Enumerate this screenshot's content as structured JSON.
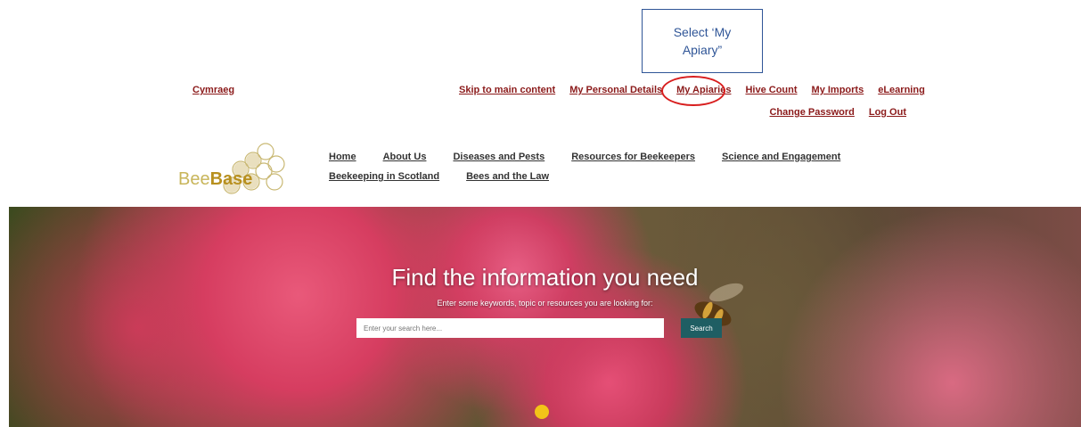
{
  "annotation": {
    "line1": "Select ‘My",
    "line2": "Apiary”"
  },
  "language_link": "Cymraeg",
  "utility_nav": [
    "Skip to main content",
    "My Personal Details",
    "My Apiaries",
    "Hive Count",
    "My Imports",
    "eLearning"
  ],
  "account_nav": [
    "Change Password",
    "Log Out"
  ],
  "logo": {
    "part1": "Bee",
    "part2": "Base"
  },
  "main_nav": {
    "row1": [
      "Home",
      "About Us",
      "Diseases and Pests",
      "Resources for Beekeepers",
      "Science and Engagement"
    ],
    "row2": [
      "Beekeeping in Scotland",
      "Bees and the Law"
    ]
  },
  "hero": {
    "title": "Find the information you need",
    "subtitle": "Enter some keywords, topic or resources you are looking for:",
    "search_placeholder": "Enter your search here...",
    "search_button": "Search"
  },
  "colors": {
    "link": "#8b1a1a",
    "highlight": "#d81e1e",
    "button": "#1f5e63",
    "callout": "#2f5597"
  }
}
